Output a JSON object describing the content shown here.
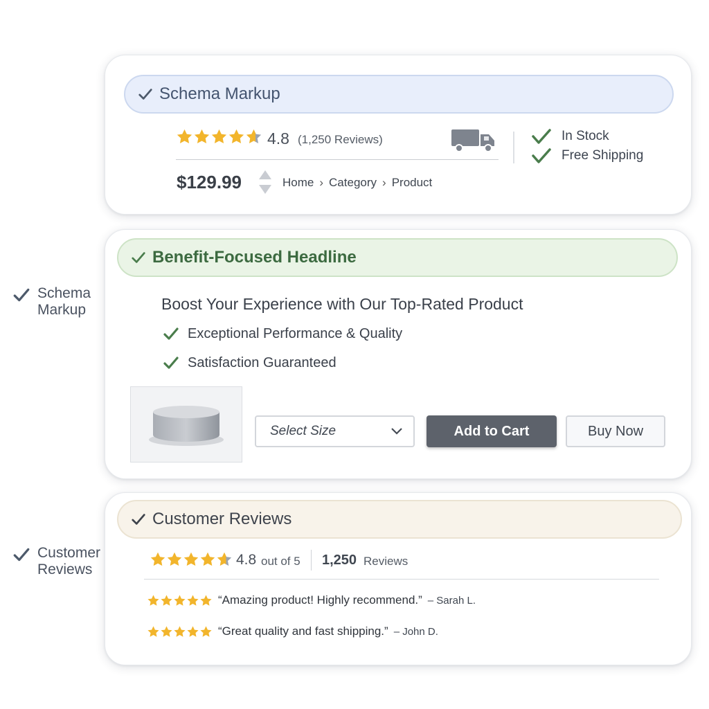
{
  "colors": {
    "accent_green": "#4a7d4c",
    "check_slate": "#4d5a6b",
    "star_gold": "#f2b52c",
    "button_dark": "#5d626b"
  },
  "icons": [
    "check-icon",
    "star-icon",
    "delivery-truck-icon",
    "sort-arrows-icon",
    "chevron-down-icon",
    "product-image"
  ],
  "side_labels": [
    {
      "text": "Schema Markup"
    },
    {
      "text": "Customer Reviews"
    }
  ],
  "schema_card": {
    "title": "Schema Markup",
    "rating": "4.8",
    "rating_value": 4.8,
    "review_count_text": "(1,250 Reviews)",
    "price": "$129.99",
    "breadcrumb": [
      "Home",
      "Category",
      "Product"
    ],
    "breadcrumb_sep": "›",
    "stock": "In Stock",
    "shipping": "Free Shipping"
  },
  "headline_card": {
    "title": "Benefit-Focused Headline",
    "headline": "Boost Your Experience with Our Top-Rated Product",
    "bullets": [
      "Exceptional Performance & Quality",
      "Satisfaction Guaranteed"
    ],
    "select_placeholder": "Select Size",
    "add_to_cart": "Add to Cart",
    "buy_now": "Buy Now"
  },
  "reviews_card": {
    "title": "Customer Reviews",
    "rating": "4.8",
    "out_of": "out of 5",
    "rating_value": 4.8,
    "count": "1,250",
    "count_label": "Reviews",
    "reviews": [
      {
        "quote": "“Amazing product! Highly recommend.”",
        "author": "– Sarah L.",
        "stars": 5
      },
      {
        "quote": "“Great quality and fast shipping.”",
        "author": "– John D.",
        "stars": 5
      }
    ]
  }
}
